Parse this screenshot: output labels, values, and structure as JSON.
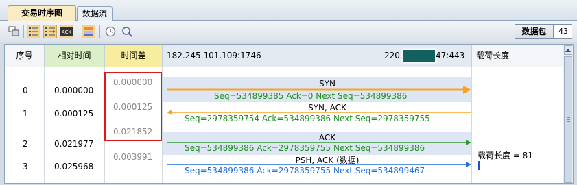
{
  "tabs": [
    "交易时序图",
    "数据流"
  ],
  "toolbar": {
    "packets_label": "数据包",
    "packets_count": "43"
  },
  "columns": {
    "seq": "序号",
    "rel_time": "相对时间",
    "time_diff": "时间差",
    "left_endpoint": "182.245.101.109:1746",
    "right_endpoint_prefix": "220.",
    "right_endpoint_suffix": "47:443",
    "payload": "载荷长度"
  },
  "rows": [
    {
      "seq": "0",
      "rel_time": "0.000000"
    },
    {
      "seq": "1",
      "rel_time": "0.000125"
    },
    {
      "seq": "2",
      "rel_time": "0.021977"
    },
    {
      "seq": "3",
      "rel_time": "0.025968"
    }
  ],
  "diffs": [
    "0.000000",
    "0.000125",
    "0.021852",
    "0.003991"
  ],
  "packets": [
    {
      "flag": "SYN",
      "detail": "Seq=534899385  Ack=0  Next Seq=534899386",
      "color": "#f5a623",
      "text_color": "#1e8f1e"
    },
    {
      "flag": "SYN, ACK",
      "detail": "Seq=2978359754  Ack=534899386  Next Seq=2978359755",
      "color": "#f5a623",
      "text_color": "#1e8f1e"
    },
    {
      "flag": "ACK",
      "detail": "Seq=534899386  Ack=2978359755  Next Seq=534899386",
      "color": "#2e9b2e",
      "text_color": "#1e8f1e"
    },
    {
      "flag": "PSH, ACK (数据)",
      "detail": "Seq=534899386  Ack=2978359755  Next Seq=534899467",
      "color": "#1f6fe0",
      "text_color": "#1f6fe0"
    }
  ],
  "payload_note": "载荷长度 = 81",
  "colors": {
    "rel_col": "#dbf0c8",
    "diff_col": "#f8f0b0",
    "diff_highlight": "#d91a1a",
    "flow_band": "#dfe6f3"
  }
}
